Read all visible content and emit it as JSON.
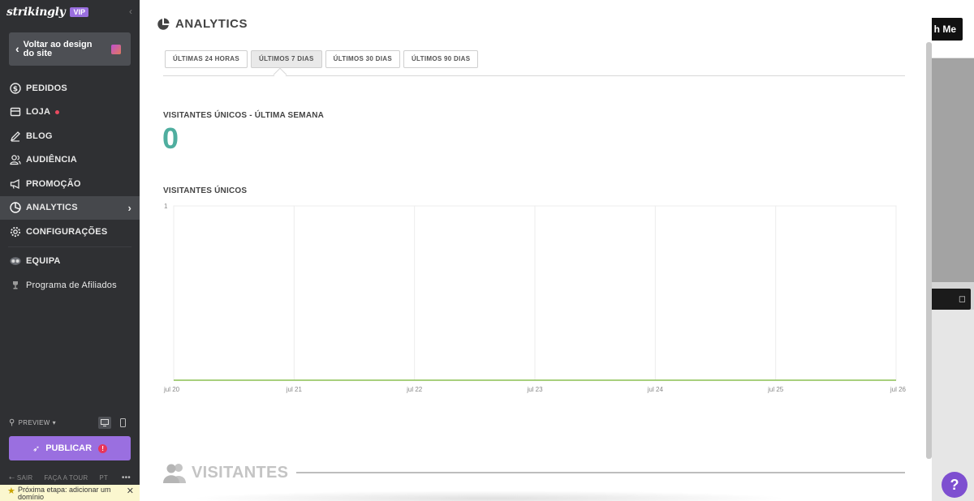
{
  "background": {
    "button_fragment": "h Me"
  },
  "sidebar": {
    "logo": "strikingly",
    "badge": "VIP",
    "back_label": "Voltar ao design do site",
    "items": [
      {
        "name": "pedidos",
        "label": "PEDIDOS",
        "icon": "dollar-circle-icon"
      },
      {
        "name": "loja",
        "label": "LOJA",
        "icon": "store-icon",
        "notification": true
      },
      {
        "name": "blog",
        "label": "BLOG",
        "icon": "pen-icon"
      },
      {
        "name": "audiencia",
        "label": "AUDIÊNCIA",
        "icon": "people-icon"
      },
      {
        "name": "promocao",
        "label": "PROMOÇÃO",
        "icon": "megaphone-icon"
      },
      {
        "name": "analytics",
        "label": "ANALYTICS",
        "icon": "pie-chart-icon",
        "active": true
      },
      {
        "name": "configuracoes",
        "label": "CONFIGURAÇÕES",
        "icon": "gear-icon"
      }
    ],
    "team_label": "EQUIPA",
    "affiliate_label": "Programa de Afiliados",
    "preview_label": "PREVIEW",
    "publish_label": "PUBLICAR",
    "footer": {
      "exit": "SAIR",
      "tour": "FAÇA A TOUR",
      "lang": "PT"
    },
    "next_step": "Próxima etapa: adicionar um domínio"
  },
  "analytics": {
    "title": "ANALYTICS",
    "tabs": [
      {
        "label": "ÚLTIMAS 24 HORAS",
        "active": false
      },
      {
        "label": "ÚLTIMOS 7 DIAS",
        "active": true
      },
      {
        "label": "ÚLTIMOS 30 DIAS",
        "active": false
      },
      {
        "label": "ÚLTIMOS 90 DIAS",
        "active": false
      }
    ],
    "unique_week_label": "VISITANTES ÚNICOS - ÚLTIMA SEMANA",
    "unique_week_value": "0",
    "chart_label": "VISITANTES ÚNICOS",
    "visitors_heading": "VISITANTES"
  },
  "chart_data": {
    "type": "line",
    "categories": [
      "jul 20",
      "jul 21",
      "jul 22",
      "jul 23",
      "jul 24",
      "jul 25",
      "jul 26"
    ],
    "series": [
      {
        "values": [
          0,
          0,
          0,
          0,
          0,
          0,
          0
        ],
        "color": "#8cc152"
      }
    ],
    "ylim": [
      0,
      1
    ],
    "yticks": [
      "1"
    ],
    "grid": true
  },
  "help": {
    "label": "?"
  }
}
